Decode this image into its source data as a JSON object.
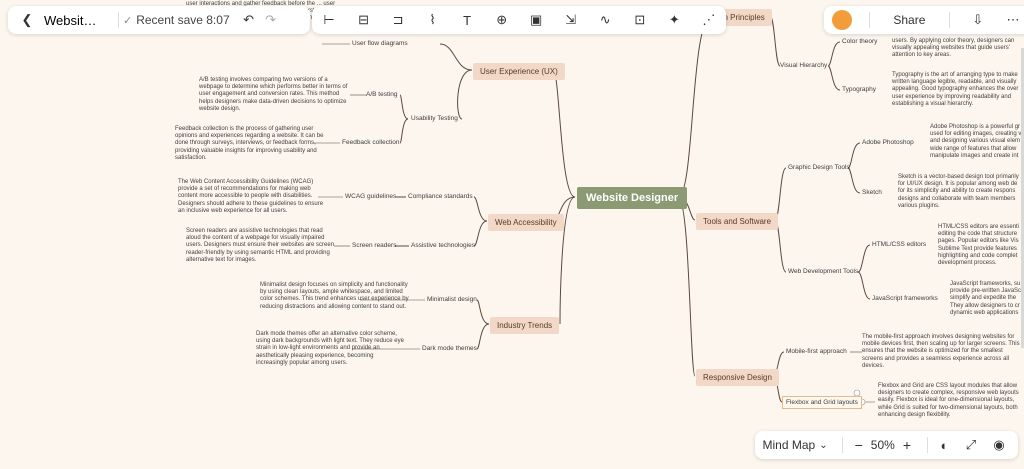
{
  "header": {
    "back_icon": "chevron-left-icon",
    "title": "Websit…",
    "save_status": "Recent save 8:07",
    "undo_icon": "undo-icon",
    "redo_icon": "redo-icon"
  },
  "tools": [
    "child-topic-icon",
    "sibling-topic-icon",
    "summary-icon",
    "format-painter-icon",
    "text-icon",
    "insert-icon",
    "frame-icon",
    "relationship-icon",
    "connector-icon",
    "presentation-icon",
    "ai-magic-icon",
    "clean-icon"
  ],
  "right_bar": {
    "share_label": "Share",
    "logo_icon": "app-logo-icon",
    "download_icon": "download-icon",
    "more_icon": "more-icon"
  },
  "bottom_bar": {
    "view_label": "Mind Map",
    "zoom": "50%",
    "minus": "−",
    "plus": "+"
  },
  "mindmap": {
    "root": "Website Designer",
    "ux": {
      "label": "User Experience (UX)",
      "flow": "User flow diagrams",
      "flow_text": "user interactions and gather feedback before the ... user takes on a website. They help designers understand user journeys and identify potential bottlenecks to improve navigation and overall user experience.",
      "testing": "Usability Testing",
      "ab": "A/B testing",
      "ab_text": "A/B testing involves comparing two versions of a webpage to determine which performs better in terms of user engagement and conversion rates. This method helps designers make data-driven decisions to optimize website design.",
      "feedback": "Feedback collection",
      "feedback_text": "Feedback collection is the process of gathering user opinions and experiences regarding a website. It can be done through surveys, interviews, or feedback forms, providing valuable insights for improving usability and satisfaction."
    },
    "access": {
      "label": "Web Accessibility",
      "standards": "Compliance standards",
      "wcag": "WCAG guidelines",
      "wcag_text": "The Web Content Accessibility Guidelines (WCAG) provide a set of recommendations for making web content more accessible to people with disabilities. Designers should adhere to these guidelines to ensure an inclusive web experience for all users.",
      "assistive": "Assistive technologies",
      "readers": "Screen readers",
      "readers_text": "Screen readers are assistive technologies that read aloud the content of a webpage for visually impaired users. Designers must ensure their websites are screen reader-friendly by using semantic HTML and providing alternative text for images."
    },
    "trends": {
      "label": "Industry Trends",
      "minimal": "Minimalist design",
      "minimal_text": "Minimalist design focuses on simplicity and functionality by using clean layouts, ample whitespace, and limited color schemes. This trend enhances user experience by reducing distractions and allowing content to stand out.",
      "dark": "Dark mode themes",
      "dark_text": "Dark mode themes offer an alternative color scheme, using dark backgrounds with light text. They reduce eye strain in low-light environments and provide an aesthetically pleasing experience, becoming increasingly popular among users."
    },
    "design": {
      "label": "gn Principles",
      "visual": "Visual Hierarchy",
      "color": "Color theory",
      "color_text": "users. By applying color theory, designers can visually appealing websites that guide users' attention to key areas.",
      "typo": "Typography",
      "typo_text": "Typography is the art of arranging type to make written language legible, readable, and visually appealing. Good typography enhances the over user experience by improving readability and establishing a visual hierarchy."
    },
    "tools": {
      "label": "Tools and Software",
      "graphic": "Graphic Design Tools",
      "ps": "Adobe Photoshop",
      "ps_text": "Adobe Photoshop is a powerful gr used for editing images, creating v and designing various visual elem wide range of features that allow manipulate images and create int",
      "sketch": "Sketch",
      "sketch_text": "Sketch is a vector-based design tool primarily for UI/UX design. It is popular among web de for its simplicity and ability to create respons designs and collaborate with team members various plugins.",
      "webdev": "Web Development Tools",
      "editors": "HTML/CSS editors",
      "editors_text": "HTML/CSS editors are essenti editing the code that structure pages. Popular editors like Vis Sublime Text provide features highlighting and code complet development process.",
      "js": "JavaScript frameworks",
      "js_text": "JavaScript frameworks, su provide pre-written JavaSc simplify and expedite the They allow designers to cr dynamic web applications"
    },
    "responsive": {
      "label": "Responsive Design",
      "mobile": "Mobile-first approach",
      "mobile_text": "The mobile-first approach involves designing websites for mobile devices first, then scaling up for larger screens. This ensures that the website is optimized for the smallest screens and provides a seamless experience across all devices.",
      "flex": "Flexbox and Grid layouts",
      "flex_text": "Flexbox and Grid are CSS layout modules that allow designers to create complex, responsive web layouts easily. Flexbox is ideal for one-dimensional layouts, while Grid is suited for two-dimensional layouts, both enhancing design flexibility."
    }
  }
}
